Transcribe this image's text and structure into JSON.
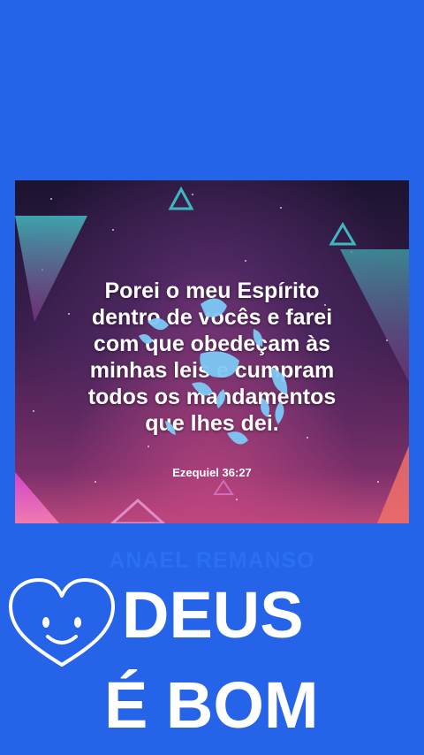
{
  "card": {
    "quote_lines": [
      "Porei o meu Espírito",
      "dentro de vocês e farei",
      "com que obedeçam às",
      "minhas leis e cumpram",
      "todos os mandamentos",
      "que lhes dei."
    ],
    "reference": "Ezequiel 36:27"
  },
  "author": "ANAEL REMANSO",
  "headline": {
    "line1": "DEUS",
    "line2": "É BOM"
  },
  "colors": {
    "background": "#2563e8",
    "author": "#2b6ff2",
    "headline": "#ffffff",
    "splash": "#7ec8f5"
  },
  "icons": {
    "heart": "smiling-heart-icon"
  }
}
